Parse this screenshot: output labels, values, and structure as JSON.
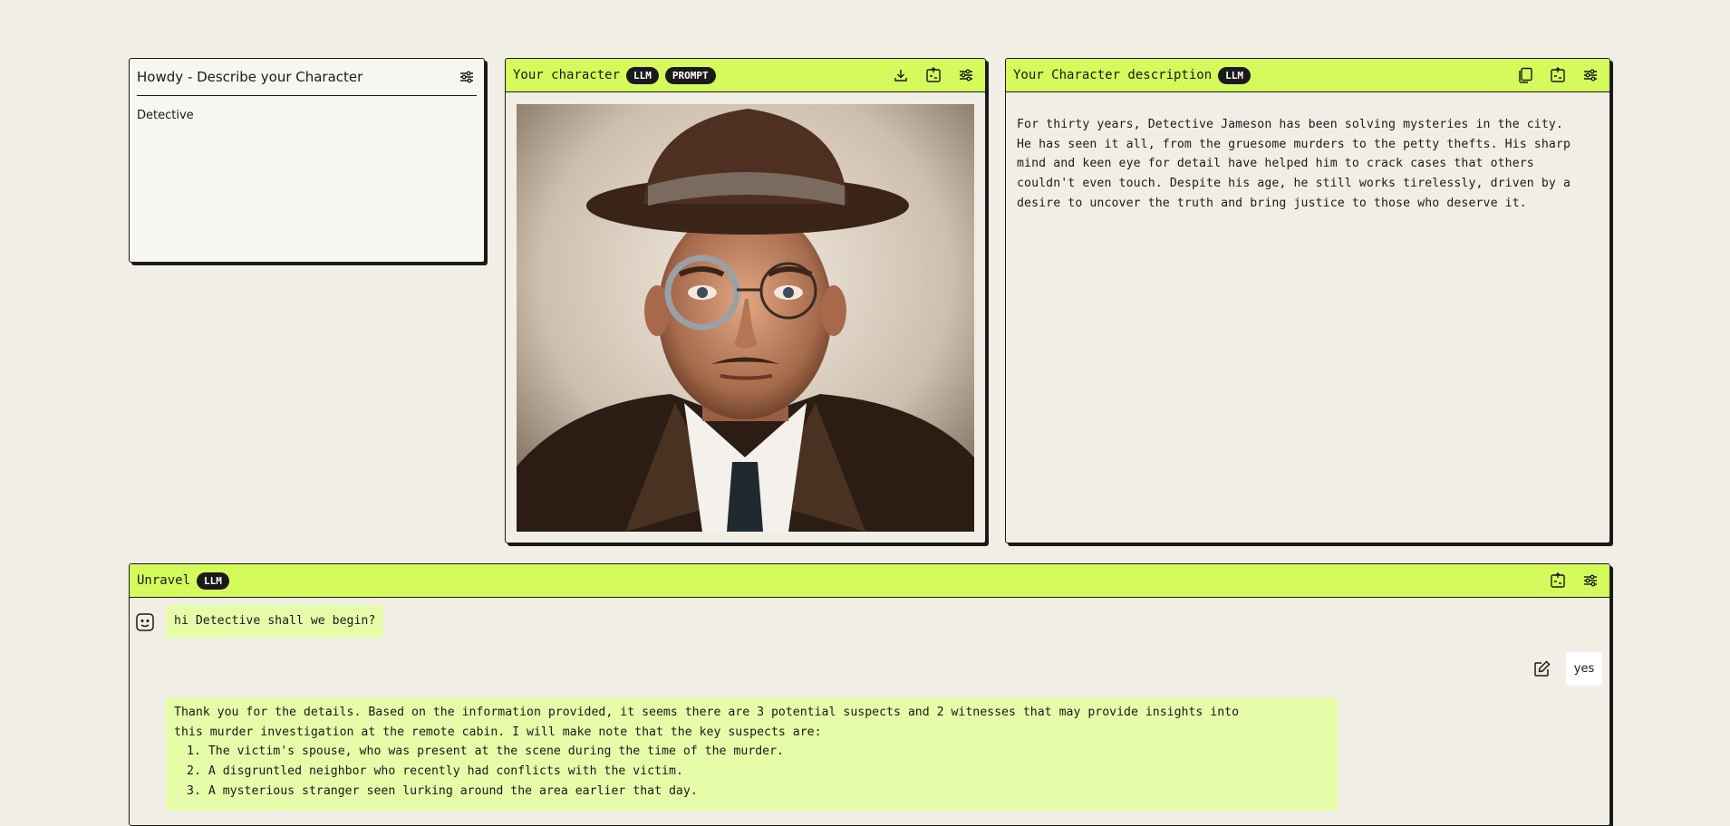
{
  "panel_describe": {
    "title": "Howdy - Describe your Character",
    "value": "Detective",
    "icons": [
      "sliders-icon"
    ]
  },
  "panel_character": {
    "title": "Your character",
    "badges": [
      "LLM",
      "PROMPT"
    ],
    "icons": [
      "download-icon",
      "export-icon",
      "sliders-icon"
    ],
    "image_alt": "Portrait of a detective in a fedora hat with a monocle"
  },
  "panel_description": {
    "title": "Your Character description",
    "badges": [
      "LLM"
    ],
    "icons": [
      "copy-icon",
      "export-icon",
      "sliders-icon"
    ],
    "lines": [
      "For thirty years, Detective Jameson has been solving mysteries in the city.",
      "He has seen it all, from the gruesome murders to the petty thefts. His sharp",
      "mind and keen eye for detail have helped him to crack cases that others",
      "couldn't even touch. Despite his age, he still works tirelessly, driven by a",
      "desire to uncover the truth and bring justice to those who deserve it."
    ]
  },
  "panel_unravel": {
    "title": "Unravel",
    "badges": [
      "LLM"
    ],
    "icons": [
      "export-icon",
      "sliders-icon"
    ],
    "messages": {
      "bot1": "hi Detective shall we begin?",
      "user1": "yes",
      "bot2_intro_1": "Thank you for the details. Based on the information provided, it seems there are 3 potential suspects and 2 witnesses that may provide insights into",
      "bot2_intro_2": "this murder investigation at the remote cabin. I will make note that the key suspects are:",
      "bot2_list": [
        "The victim's spouse, who was present at the scene during the time of the murder.",
        "A disgruntled neighbor who recently had conflicts with the victim.",
        "A mysterious stranger seen lurking around the area earlier that day."
      ]
    }
  },
  "colors": {
    "background": "#f1efe5",
    "accent": "#d4fa5c",
    "bot_bubble": "#e7fca9",
    "dark": "#1a1a1a"
  }
}
